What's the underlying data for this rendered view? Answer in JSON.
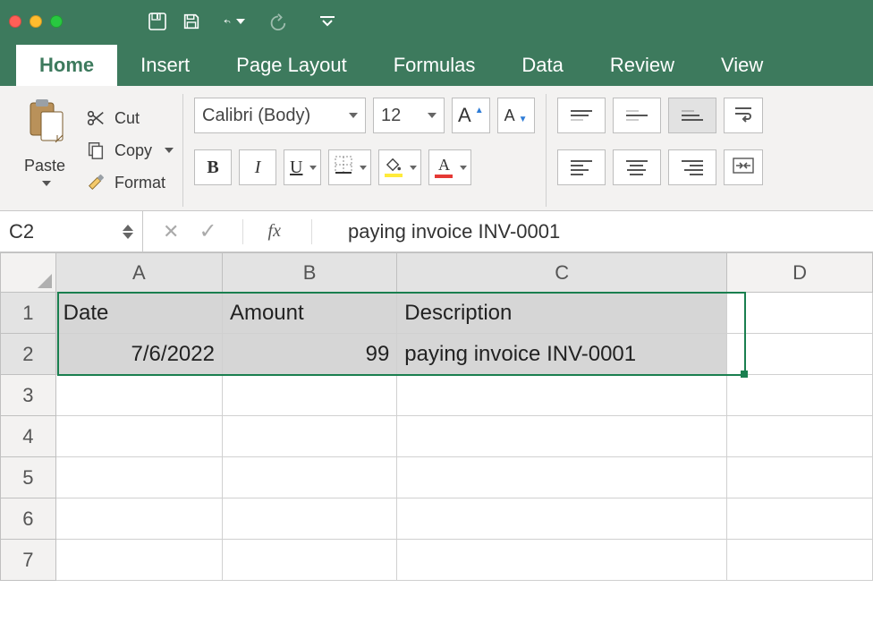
{
  "tabs": {
    "home": "Home",
    "insert": "Insert",
    "page_layout": "Page Layout",
    "formulas": "Formulas",
    "data": "Data",
    "review": "Review",
    "view": "View"
  },
  "ribbon": {
    "paste": "Paste",
    "cut": "Cut",
    "copy": "Copy",
    "format": "Format",
    "font_name": "Calibri (Body)",
    "font_size": "12"
  },
  "formula_bar": {
    "cell_ref": "C2",
    "fx": "fx",
    "value": "paying invoice INV-0001"
  },
  "columns": [
    "A",
    "B",
    "C",
    "D"
  ],
  "rows": [
    "1",
    "2",
    "3",
    "4",
    "5",
    "6",
    "7"
  ],
  "sheet": {
    "headers": {
      "A": "Date",
      "B": "Amount",
      "C": "Description"
    },
    "row2": {
      "A": "7/6/2022",
      "B": "99",
      "C": "paying invoice INV-0001"
    }
  },
  "col_widths": {
    "row": 64,
    "A": 190,
    "B": 200,
    "C": 380,
    "D": 170
  }
}
